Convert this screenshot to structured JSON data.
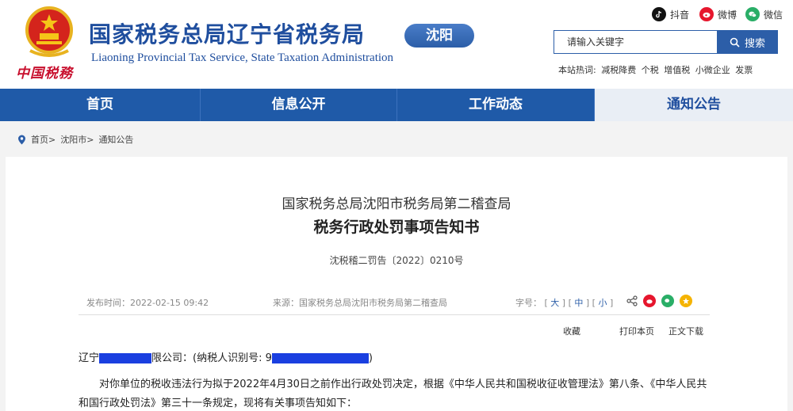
{
  "header": {
    "title_cn": "国家税务总局辽宁省税务局",
    "title_en": "Liaoning Provincial Tax Service, State Taxation Administration",
    "seal_text": "中国税務",
    "city": "沈阳"
  },
  "social": [
    {
      "label": "抖音",
      "icon": "douyin-icon",
      "color": "#111111"
    },
    {
      "label": "微博",
      "icon": "weibo-icon",
      "color": "#e6162d"
    },
    {
      "label": "微信",
      "icon": "weixin-icon",
      "color": "#2aae67"
    }
  ],
  "search": {
    "placeholder": "请输入关键字",
    "button_label": "搜索"
  },
  "hotwords": {
    "label": "本站热词:",
    "items": [
      "减税降费",
      "个税",
      "增值税",
      "小微企业",
      "发票"
    ]
  },
  "nav": [
    {
      "label": "首页"
    },
    {
      "label": "信息公开"
    },
    {
      "label": "工作动态"
    },
    {
      "label": "通知公告"
    }
  ],
  "breadcrumb": [
    "首页>",
    "沈阳市>",
    "通知公告"
  ],
  "article": {
    "org": "国家税务总局沈阳市税务局第二稽查局",
    "title": "税务行政处罚事项告知书",
    "doc_no": "沈税稽二罚告〔2022〕0210号",
    "date": "发布时间：2022-02-15 09:42",
    "source": "来源：国家税务总局沈阳市税务局第二稽查局",
    "fontsize_label": "字号：",
    "fontsizes": [
      "大",
      "中",
      "小"
    ],
    "actions": [
      "收藏",
      "打印本页",
      "正文下载"
    ],
    "addressee_prefix": "辽宁",
    "addressee_mid": "限公司：(纳税人识别号: 9",
    "addressee_suffix": ")",
    "paragraph1": "对你单位的税收违法行为拟于2022年4月30日之前作出行政处罚决定，根据《中华人民共和国税收征收管理法》第八条、《中华人民共和国行政处罚法》第三十一条规定，现将有关事项告知如下："
  },
  "colors": {
    "brand_blue": "#1f5aa8",
    "title_blue": "#1f4e9e",
    "red": "#c8102e"
  }
}
